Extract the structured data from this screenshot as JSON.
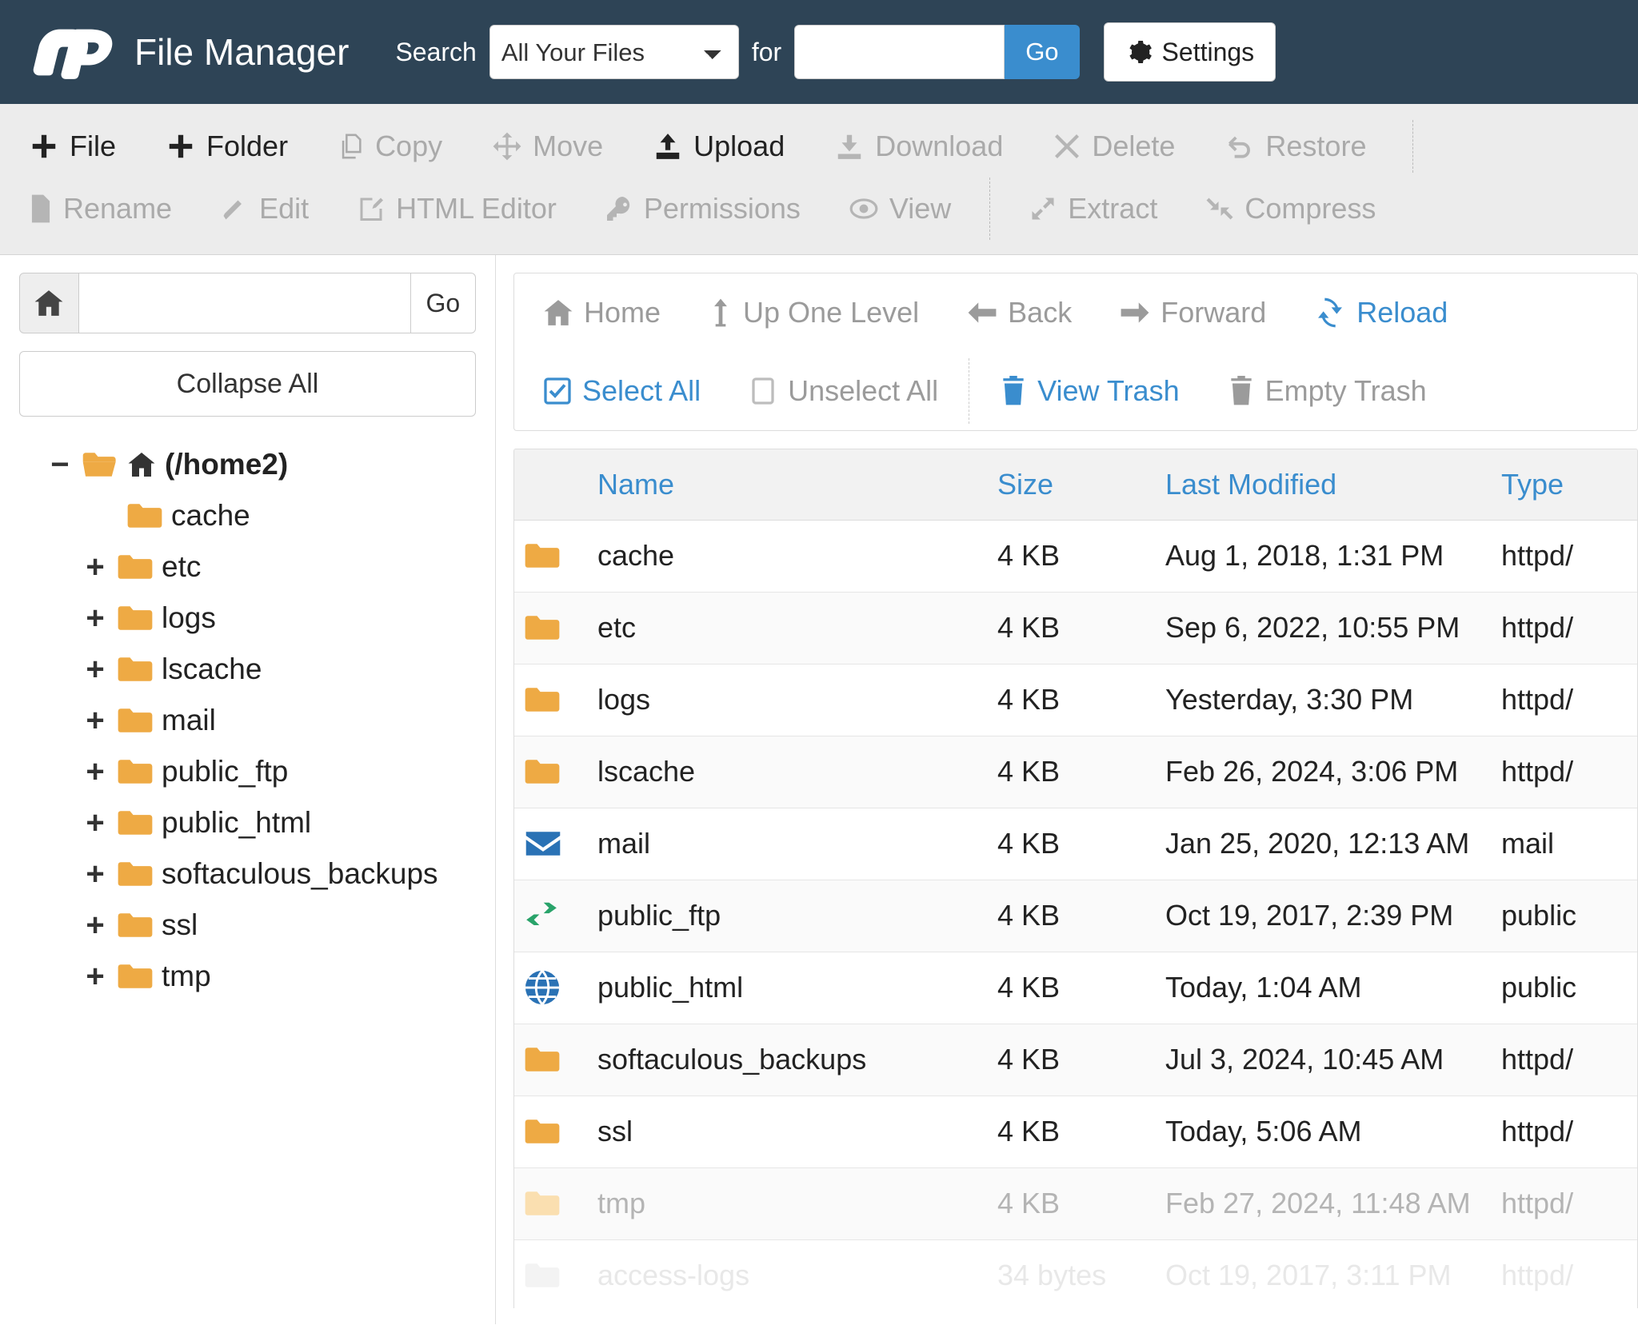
{
  "header": {
    "brand_title": "File Manager",
    "logo_icon": "cpanel-logo",
    "search_label": "Search",
    "search_scope_selected": "All Your Files",
    "search_scope_options": [
      "All Your Files"
    ],
    "for_label": "for",
    "search_value": "",
    "search_placeholder": "",
    "go_label": "Go",
    "settings_label": "Settings",
    "settings_icon": "gear-icon",
    "accent_blue": "#3a8dce",
    "header_bg": "#2e4456"
  },
  "toolbar": {
    "row1": [
      {
        "label": "File",
        "icon": "plus-icon",
        "enabled": true
      },
      {
        "label": "Folder",
        "icon": "plus-icon",
        "enabled": true
      },
      {
        "label": "Copy",
        "icon": "copy-icon",
        "enabled": false
      },
      {
        "label": "Move",
        "icon": "move-icon",
        "enabled": false
      },
      {
        "label": "Upload",
        "icon": "upload-icon",
        "enabled": true
      },
      {
        "label": "Download",
        "icon": "download-icon",
        "enabled": false
      },
      {
        "label": "Delete",
        "icon": "times-icon",
        "enabled": false
      },
      {
        "label": "Restore",
        "icon": "undo-icon",
        "enabled": false
      }
    ],
    "row2": [
      {
        "label": "Rename",
        "icon": "file-icon",
        "enabled": false
      },
      {
        "label": "Edit",
        "icon": "pencil-icon",
        "enabled": false
      },
      {
        "label": "HTML Editor",
        "icon": "html-editor-icon",
        "enabled": false
      },
      {
        "label": "Permissions",
        "icon": "key-icon",
        "enabled": false
      },
      {
        "label": "View",
        "icon": "eye-icon",
        "enabled": false
      },
      {
        "label": "Extract",
        "icon": "expand-icon",
        "enabled": false
      },
      {
        "label": "Compress",
        "icon": "compress-icon",
        "enabled": false
      }
    ]
  },
  "sidebar": {
    "home_icon": "home-icon",
    "path_value": "",
    "path_placeholder": "",
    "go_label": "Go",
    "collapse_all_label": "Collapse All",
    "tree": [
      {
        "label": "(/home2)",
        "toggle": "−",
        "icon": "folder-open-home-icon",
        "depth": 0
      },
      {
        "label": "cache",
        "toggle": "",
        "icon": "folder-icon",
        "depth": 1
      },
      {
        "label": "etc",
        "toggle": "+",
        "icon": "folder-icon",
        "depth": 1
      },
      {
        "label": "logs",
        "toggle": "+",
        "icon": "folder-icon",
        "depth": 1
      },
      {
        "label": "lscache",
        "toggle": "+",
        "icon": "folder-icon",
        "depth": 1
      },
      {
        "label": "mail",
        "toggle": "+",
        "icon": "folder-icon",
        "depth": 1
      },
      {
        "label": "public_ftp",
        "toggle": "+",
        "icon": "folder-icon",
        "depth": 1
      },
      {
        "label": "public_html",
        "toggle": "+",
        "icon": "folder-icon",
        "depth": 1
      },
      {
        "label": "softaculous_backups",
        "toggle": "+",
        "icon": "folder-icon",
        "depth": 1
      },
      {
        "label": "ssl",
        "toggle": "+",
        "icon": "folder-icon",
        "depth": 1
      },
      {
        "label": "tmp",
        "toggle": "+",
        "icon": "folder-icon",
        "depth": 1
      }
    ]
  },
  "main": {
    "nav_row1": [
      {
        "label": "Home",
        "icon": "home-icon",
        "active": false
      },
      {
        "label": "Up One Level",
        "icon": "up-arrow-icon",
        "active": false
      },
      {
        "label": "Back",
        "icon": "arrow-left-icon",
        "active": false
      },
      {
        "label": "Forward",
        "icon": "arrow-right-icon",
        "active": false
      },
      {
        "label": "Reload",
        "icon": "reload-icon",
        "active": true
      }
    ],
    "nav_row2": [
      {
        "label": "Select All",
        "icon": "checkbox-checked-icon",
        "active": true
      },
      {
        "label": "Unselect All",
        "icon": "checkbox-empty-icon",
        "active": false
      },
      {
        "label": "View Trash",
        "icon": "trash-icon",
        "active": true
      },
      {
        "label": "Empty Trash",
        "icon": "trash-icon",
        "active": false
      }
    ],
    "columns": [
      "Name",
      "Size",
      "Last Modified",
      "Type"
    ],
    "rows": [
      {
        "icon": "folder-icon",
        "name": "cache",
        "size": "4 KB",
        "modified": "Aug 1, 2018, 1:31 PM",
        "type": "httpd/",
        "dim": false
      },
      {
        "icon": "folder-icon",
        "name": "etc",
        "size": "4 KB",
        "modified": "Sep 6, 2022, 10:55 PM",
        "type": "httpd/",
        "dim": false
      },
      {
        "icon": "folder-icon",
        "name": "logs",
        "size": "4 KB",
        "modified": "Yesterday, 3:30 PM",
        "type": "httpd/",
        "dim": false
      },
      {
        "icon": "folder-icon",
        "name": "lscache",
        "size": "4 KB",
        "modified": "Feb 26, 2024, 3:06 PM",
        "type": "httpd/",
        "dim": false
      },
      {
        "icon": "envelope-icon",
        "name": "mail",
        "size": "4 KB",
        "modified": "Jan 25, 2020, 12:13 AM",
        "type": "mail",
        "dim": false
      },
      {
        "icon": "exchange-icon",
        "name": "public_ftp",
        "size": "4 KB",
        "modified": "Oct 19, 2017, 2:39 PM",
        "type": "public",
        "dim": false
      },
      {
        "icon": "globe-icon",
        "name": "public_html",
        "size": "4 KB",
        "modified": "Today, 1:04 AM",
        "type": "public",
        "dim": false
      },
      {
        "icon": "folder-icon",
        "name": "softaculous_backups",
        "size": "4 KB",
        "modified": "Jul 3, 2024, 10:45 AM",
        "type": "httpd/",
        "dim": false
      },
      {
        "icon": "folder-icon",
        "name": "ssl",
        "size": "4 KB",
        "modified": "Today, 5:06 AM",
        "type": "httpd/",
        "dim": false
      },
      {
        "icon": "folder-icon",
        "name": "tmp",
        "size": "4 KB",
        "modified": "Feb 27, 2024, 11:48 AM",
        "type": "httpd/",
        "dim": true
      },
      {
        "icon": "folder-icon",
        "name": "access-logs",
        "size": "34 bytes",
        "modified": "Oct 19, 2017, 3:11 PM",
        "type": "httpd/",
        "dim": true
      }
    ]
  }
}
